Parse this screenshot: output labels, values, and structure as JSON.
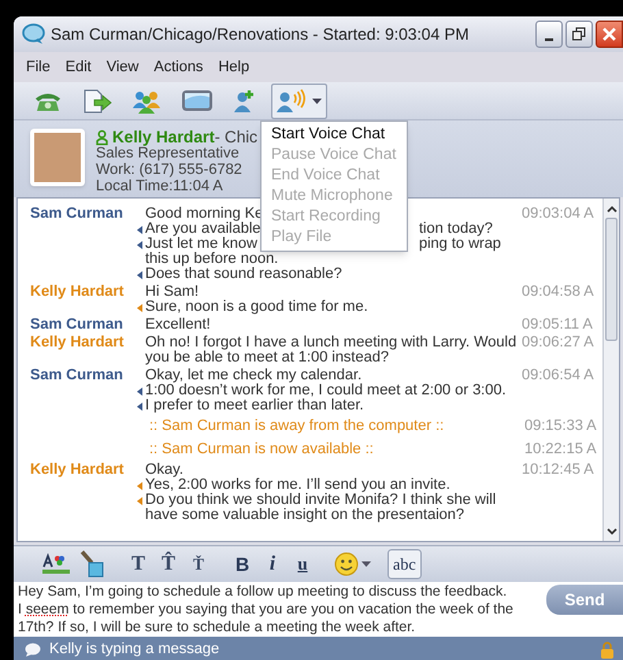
{
  "window": {
    "title": "Sam Curman/Chicago/Renovations - Started: 9:03:04 PM"
  },
  "menu_bar": [
    "File",
    "Edit",
    "View",
    "Actions",
    "Help"
  ],
  "toolbar": [
    {
      "kind": "phone",
      "pressed": false
    },
    {
      "kind": "send-file",
      "pressed": false
    },
    {
      "kind": "group",
      "pressed": false
    },
    {
      "kind": "screen",
      "pressed": false
    },
    {
      "kind": "add-contact",
      "pressed": false
    },
    {
      "kind": "voice",
      "pressed": true
    }
  ],
  "voice_menu": [
    {
      "label": "Start Voice Chat",
      "disabled": false
    },
    {
      "label": "Pause Voice Chat",
      "disabled": true
    },
    {
      "label": "End Voice Chat",
      "disabled": true
    },
    {
      "label": "Mute Microphone",
      "disabled": true
    },
    {
      "label": "Start Recording",
      "disabled": true
    },
    {
      "label": "Play File",
      "disabled": true
    }
  ],
  "contact": {
    "name": "Kelly Hardart",
    "location": " - Chic",
    "title": "Sales Representative",
    "phone": "Work: (617) 555-6782",
    "local_time": "Local Time:11:04 A"
  },
  "messages": [
    {
      "kind": "message",
      "sender": "Sam Curman",
      "color": "#3d5a8c",
      "time": "09:03:04 A",
      "lines": [
        {
          "text": "Good morning Ke",
          "continued": false
        },
        {
          "text": "Are you available",
          "right": "tion today?",
          "continued": true
        },
        {
          "text": "Just let me know",
          "right": "ping to wrap",
          "continued": true
        },
        {
          "text": "this up before noon.",
          "continued": false
        },
        {
          "text": "Does that sound reasonable?",
          "continued": true
        }
      ]
    },
    {
      "kind": "message",
      "sender": "Kelly Hardart",
      "color": "#e08a18",
      "time": "09:04:58 A",
      "lines": [
        {
          "text": "Hi Sam!",
          "continued": false
        },
        {
          "text": "Sure, noon is a good time for me.",
          "continued": true
        }
      ]
    },
    {
      "kind": "message",
      "sender": "Sam Curman",
      "color": "#3d5a8c",
      "time": "09:05:11 A",
      "lines": [
        {
          "text": "Excellent!",
          "continued": false
        }
      ]
    },
    {
      "kind": "message",
      "sender": "Kelly Hardart",
      "color": "#e08a18",
      "time": "09:06:27 A",
      "lines": [
        {
          "text": "Oh no! I forgot I have a lunch meeting with Larry. Would",
          "continued": false
        },
        {
          "text": "you be able to meet at 1:00 instead?",
          "continued": false
        }
      ]
    },
    {
      "kind": "message",
      "sender": "Sam Curman",
      "color": "#3d5a8c",
      "time": "09:06:54 A",
      "lines": [
        {
          "text": "Okay, let me check my calendar.",
          "continued": false
        },
        {
          "text": "1:00 doesn’t work for me, I could meet at 2:00 or 3:00.",
          "continued": true
        },
        {
          "text": "I prefer to meet earlier than later.",
          "continued": true
        }
      ]
    },
    {
      "kind": "status",
      "text": ":: Sam Curman is away from the computer ::",
      "time": "09:15:33 A"
    },
    {
      "kind": "status",
      "text": ":: Sam Curman is now available ::",
      "time": "10:22:15 A"
    },
    {
      "kind": "message",
      "sender": "Kelly Hardart",
      "color": "#e08a18",
      "time": "10:12:45 A",
      "lines": [
        {
          "text": "Okay.",
          "continued": false
        },
        {
          "text": "Yes, 2:00 works for me. I’ll send you an invite.",
          "continued": true
        },
        {
          "text": "Do you think we should invite Monifa? I think she will",
          "continued": true
        },
        {
          "text": "have some valuable insight on the presentaion?",
          "continued": false
        }
      ]
    }
  ],
  "format_toolbar": [
    {
      "kind": "font-color"
    },
    {
      "kind": "fill"
    },
    {
      "kind": "font",
      "label": "T"
    },
    {
      "kind": "grow",
      "label": "T̂"
    },
    {
      "kind": "shrink",
      "label": "Ť"
    },
    {
      "kind": "bold",
      "label": "B"
    },
    {
      "kind": "italic",
      "label": "i"
    },
    {
      "kind": "underline",
      "label": "u"
    },
    {
      "kind": "emoticon"
    },
    {
      "kind": "spell",
      "label": "abc"
    }
  ],
  "input": {
    "lines": [
      [
        {
          "text": "Hey Sam, I’m going to schedule a follow up meeting to discuss the feedback.",
          "misspelled": false
        }
      ],
      [
        {
          "text": "I ",
          "misspelled": false
        },
        {
          "text": "seeem",
          "misspelled": true
        },
        {
          "text": " to remember you saying that you are you on vacation the week of the",
          "misspelled": false
        }
      ],
      [
        {
          "text": "17th? If so, I will be sure to schedule a meeting the week after.",
          "misspelled": false
        }
      ]
    ]
  },
  "send_button": "Send",
  "status_bar": {
    "text": "Kelly is typing a message"
  }
}
